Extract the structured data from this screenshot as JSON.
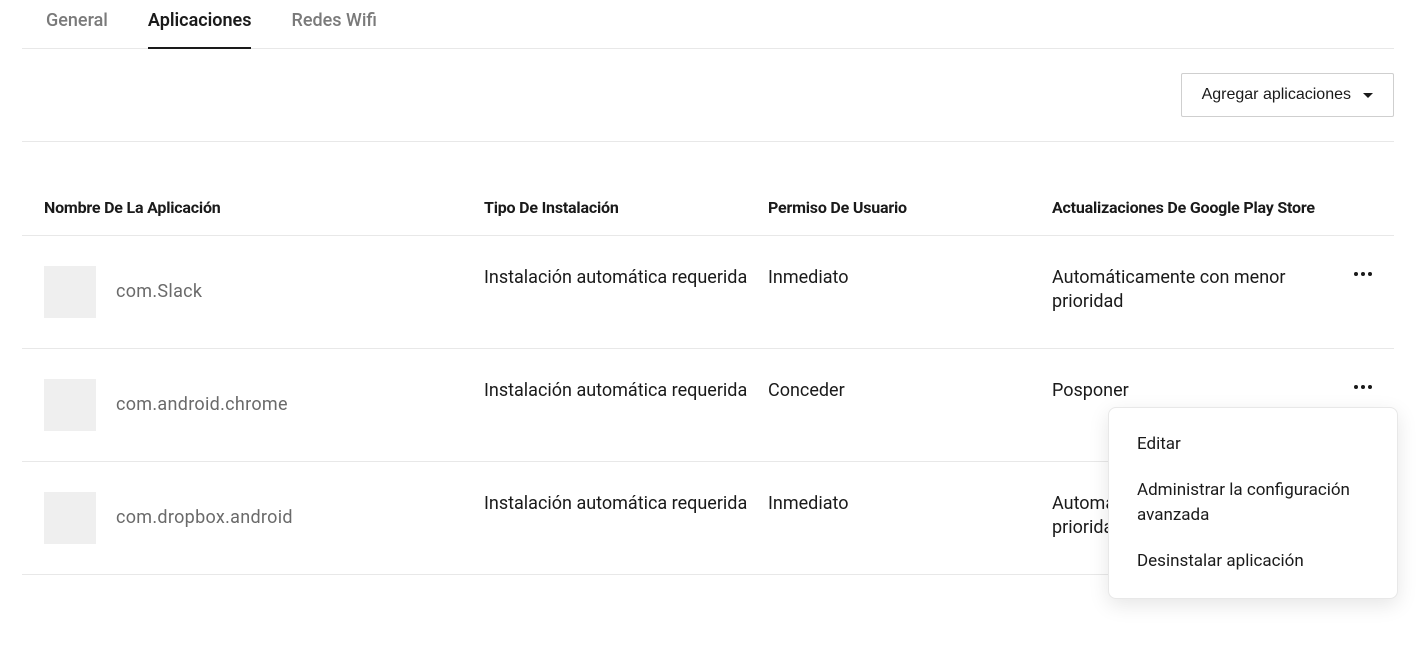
{
  "tabs": {
    "general": "General",
    "apps": "Aplicaciones",
    "wifi": "Redes Wifi"
  },
  "toolbar": {
    "add_label": "Agregar aplicaciones"
  },
  "table": {
    "headers": {
      "name": "Nombre De La Aplicación",
      "install": "Tipo De Instalación",
      "perm": "Permiso De Usuario",
      "update": "Actualizaciones De Google Play Store"
    },
    "rows": [
      {
        "name": "com.Slack",
        "install": "Instalación automática requerida",
        "perm": "Inmediato",
        "update": "Automáticamente con menor prioridad"
      },
      {
        "name": "com.android.chrome",
        "install": "Instalación automática requerida",
        "perm": "Conceder",
        "update": "Posponer"
      },
      {
        "name": "com.dropbox.android",
        "install": "Instalación automática requerida",
        "perm": "Inmediato",
        "update": "Automáticamente con menor prioridad"
      }
    ]
  },
  "popover": {
    "edit": "Editar",
    "advanced": "Administrar la configuración avanzada",
    "uninstall": "Desinstalar aplicación"
  }
}
